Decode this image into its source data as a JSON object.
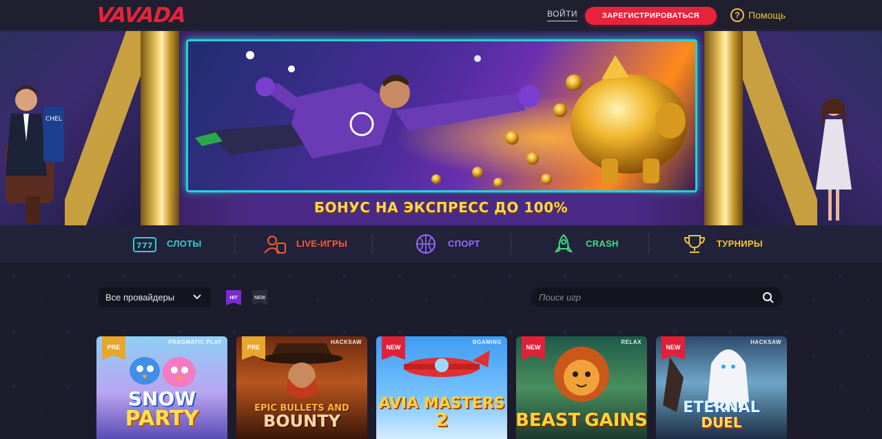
{
  "header": {
    "logo": "VAVADA",
    "login_label": "ВОЙТИ",
    "register_label": "ЗАРЕГИСТРИРОВАТЬСЯ",
    "help_label": "Помощь",
    "help_glyph": "?"
  },
  "banner": {
    "title": "БОНУС НА ЭКСПРЕСС ДО 100%"
  },
  "categories": [
    {
      "label": "СЛОТЫ",
      "color": "#2fd3d3",
      "icon": "slot-machine-icon"
    },
    {
      "label": "LIVE-ИГРЫ",
      "color": "#ff5a3a",
      "icon": "live-dealer-icon"
    },
    {
      "label": "СПОРТ",
      "color": "#9b6bff",
      "icon": "basketball-icon"
    },
    {
      "label": "CRASH",
      "color": "#44dd88",
      "icon": "rocket-icon"
    },
    {
      "label": "ТУРНИРЫ",
      "color": "#f2c53a",
      "icon": "trophy-icon"
    }
  ],
  "filters": {
    "provider_label": "Все провайдеры",
    "hit_label": "HIT",
    "new_label": "NEW",
    "search_placeholder": "Поиск игр"
  },
  "games": [
    {
      "badge": "PRE",
      "provider": "PRAGMATIC PLAY",
      "title_1": "SNOW",
      "title_2": "PARTY"
    },
    {
      "badge": "PRE",
      "provider": "HACKSAW",
      "title_1": "EPIC BULLETS AND",
      "title_2": "BOUNTY"
    },
    {
      "badge": "NEW",
      "provider": "BGAMING",
      "title_1": "AVIA MASTERS",
      "title_2": "2"
    },
    {
      "badge": "NEW",
      "provider": "RELAX",
      "title_1": "BEAST",
      "title_2": "GAINS"
    },
    {
      "badge": "NEW",
      "provider": "HACKSAW",
      "title_1": "ETERNAL",
      "title_2": "DUEL"
    }
  ]
}
